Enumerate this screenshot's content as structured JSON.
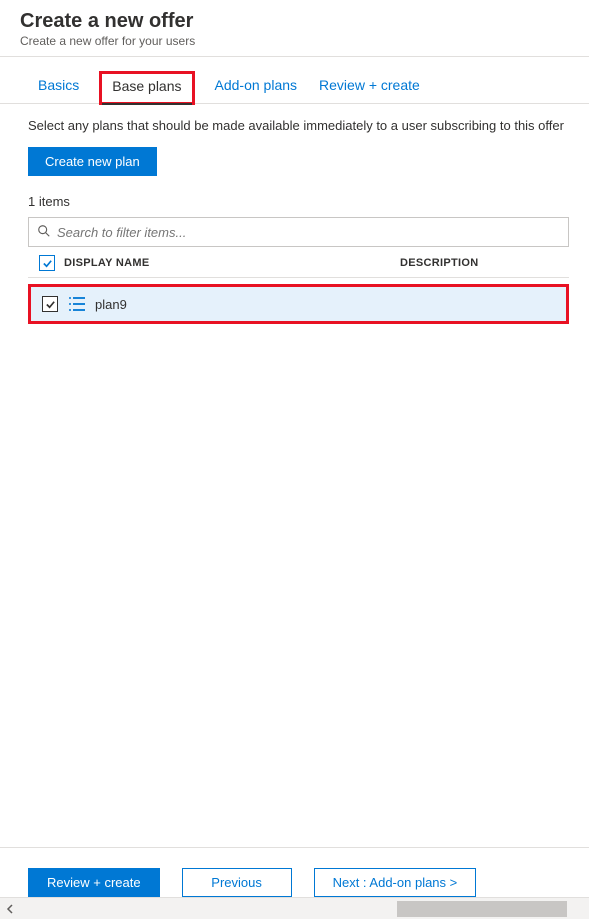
{
  "header": {
    "title": "Create a new offer",
    "subtitle": "Create a new offer for your users"
  },
  "tabs": [
    {
      "label": "Basics",
      "active": false
    },
    {
      "label": "Base plans",
      "active": true
    },
    {
      "label": "Add-on plans",
      "active": false
    },
    {
      "label": "Review + create",
      "active": false
    }
  ],
  "content": {
    "description": "Select any plans that should be made available immediately to a user subscribing to this offer",
    "create_button": "Create new plan",
    "item_count": "1 items",
    "search_placeholder": "Search to filter items...",
    "columns": {
      "name": "DISPLAY NAME",
      "description": "DESCRIPTION"
    },
    "rows": [
      {
        "name": "plan9",
        "description": "",
        "checked": true
      }
    ]
  },
  "footer": {
    "review": "Review + create",
    "previous": "Previous",
    "next": "Next : Add-on plans >"
  }
}
